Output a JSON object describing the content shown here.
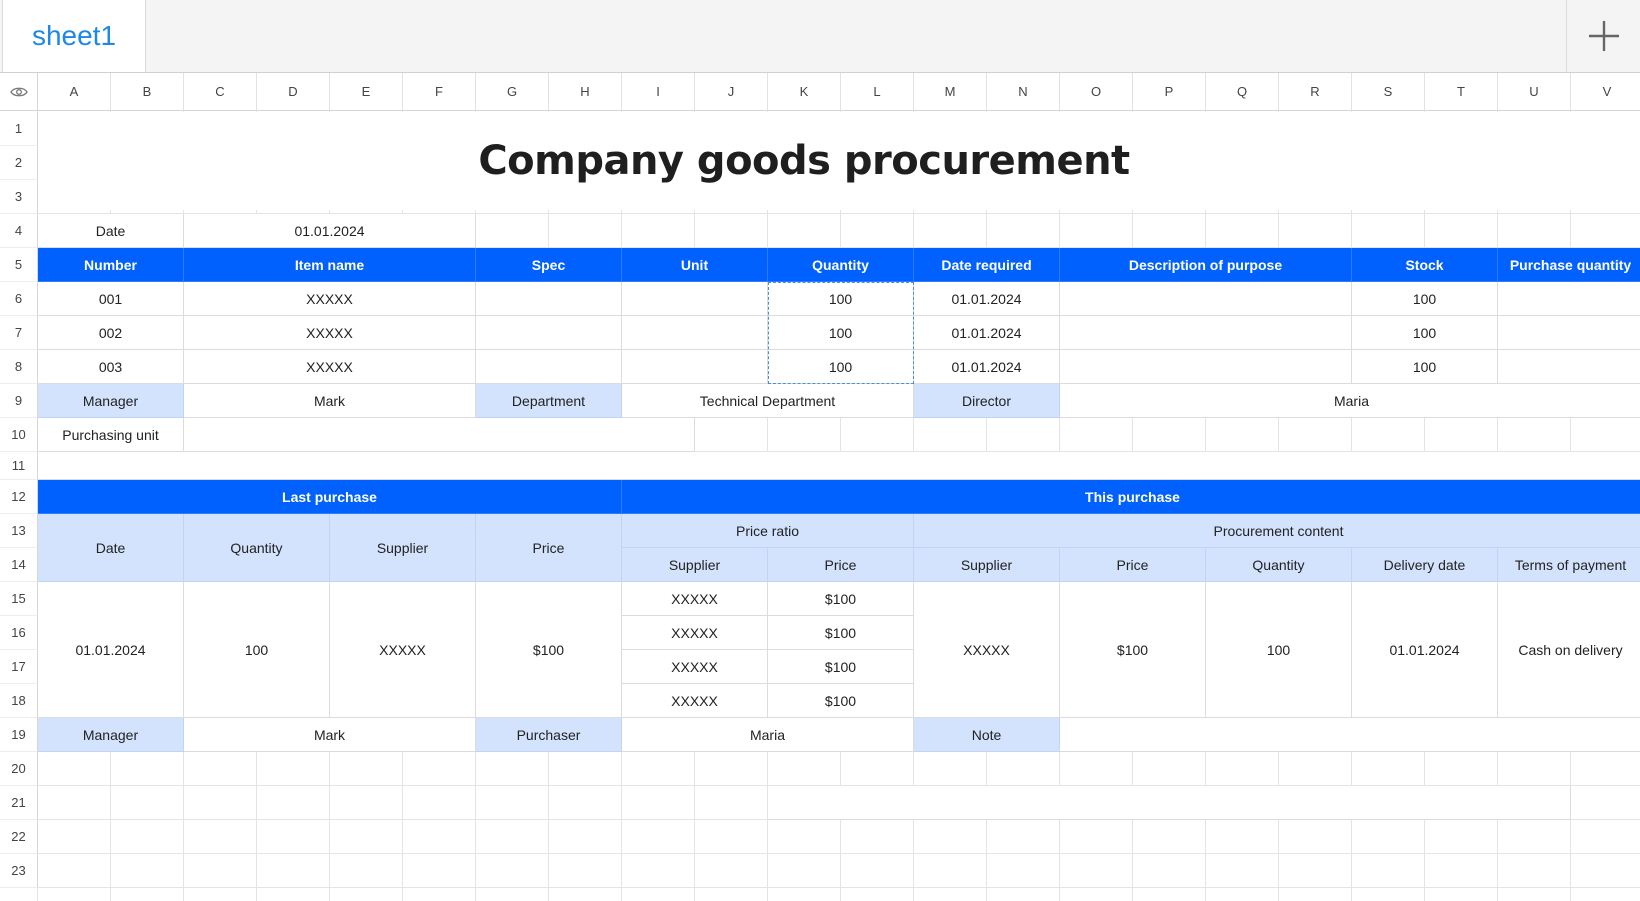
{
  "tabs": {
    "active_label": "sheet1"
  },
  "columns": [
    "A",
    "B",
    "C",
    "D",
    "E",
    "F",
    "G",
    "H",
    "I",
    "J",
    "K",
    "L",
    "M",
    "N",
    "O",
    "P",
    "Q",
    "R",
    "S",
    "T",
    "U",
    "V"
  ],
  "rows": [
    "1",
    "2",
    "3",
    "4",
    "5",
    "6",
    "7",
    "8",
    "9",
    "10",
    "11",
    "12",
    "13",
    "14",
    "15",
    "16",
    "17",
    "18",
    "19",
    "20",
    "21",
    "22",
    "23"
  ],
  "sheet": {
    "title": "Company goods procurement",
    "date_label": "Date",
    "date_value": "01.01.2024",
    "headers": {
      "number": "Number",
      "item_name": "Item name",
      "spec": "Spec",
      "unit": "Unit",
      "quantity": "Quantity",
      "date_required": "Date required",
      "description": "Description of purpose",
      "stock": "Stock",
      "purchase_quantity": "Purchase quantity"
    },
    "items": [
      {
        "number": "001",
        "name": "XXXXX",
        "quantity": "100",
        "date": "01.01.2024",
        "stock": "100"
      },
      {
        "number": "002",
        "name": "XXXXX",
        "quantity": "100",
        "date": "01.01.2024",
        "stock": "100"
      },
      {
        "number": "003",
        "name": "XXXXX",
        "quantity": "100",
        "date": "01.01.2024",
        "stock": "100"
      }
    ],
    "info_row": {
      "manager_label": "Manager",
      "manager_value": "Mark",
      "department_label": "Department",
      "department_value": "Technical Department",
      "director_label": "Director",
      "director_value": "Maria"
    },
    "purchasing_unit_label": "Purchasing unit",
    "last_purchase": {
      "header": "Last purchase",
      "date_label": "Date",
      "quantity_label": "Quantity",
      "supplier_label": "Supplier",
      "price_label": "Price",
      "date": "01.01.2024",
      "quantity": "100",
      "supplier": "XXXXX",
      "price": "$100"
    },
    "this_purchase": {
      "header": "This purchase",
      "price_ratio_label": "Price ratio",
      "procurement_label": "Procurement content",
      "supplier_label": "Supplier",
      "price_label": "Price",
      "p_supplier_label": "Supplier",
      "p_price_label": "Price",
      "p_quantity_label": "Quantity",
      "p_delivery_label": "Delivery date",
      "p_terms_label": "Terms of payment",
      "ratios": [
        {
          "supplier": "XXXXX",
          "price": "$100"
        },
        {
          "supplier": "XXXXX",
          "price": "$100"
        },
        {
          "supplier": "XXXXX",
          "price": "$100"
        },
        {
          "supplier": "XXXXX",
          "price": "$100"
        }
      ],
      "p_supplier": "XXXXX",
      "p_price": "$100",
      "p_quantity": "100",
      "p_delivery": "01.01.2024",
      "p_terms": "Cash on delivery"
    },
    "footer_row": {
      "manager_label": "Manager",
      "manager_value": "Mark",
      "purchaser_label": "Purchaser",
      "purchaser_value": "Maria",
      "note_label": "Note"
    }
  }
}
